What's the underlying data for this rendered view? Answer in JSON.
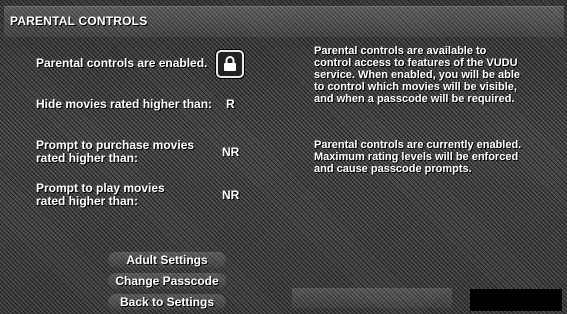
{
  "header": {
    "title": "PARENTAL CONTROLS"
  },
  "settings": {
    "enabled_label": "Parental controls are enabled.",
    "hide_label": "Hide movies rated higher than:",
    "hide_value": "R",
    "purchase_label_line1": "Prompt to purchase movies",
    "purchase_label_line2": "rated higher than:",
    "purchase_value": "NR",
    "play_label_line1": "Prompt to play movies",
    "play_label_line2": "rated higher than:",
    "play_value": "NR"
  },
  "info": {
    "p1": [
      "Parental controls are available to",
      "control access to features of the VUDU",
      "service. When enabled, you will be able",
      "to control which movies will be visible,",
      "and when a passcode will be required."
    ],
    "p2": [
      "Parental controls are currently enabled.",
      "Maximum rating levels will be enforced",
      "and cause passcode prompts."
    ]
  },
  "buttons": {
    "adult": "Adult Settings",
    "passcode": "Change Passcode",
    "back": "Back to Settings"
  },
  "icons": {
    "lock": "lock-icon"
  }
}
